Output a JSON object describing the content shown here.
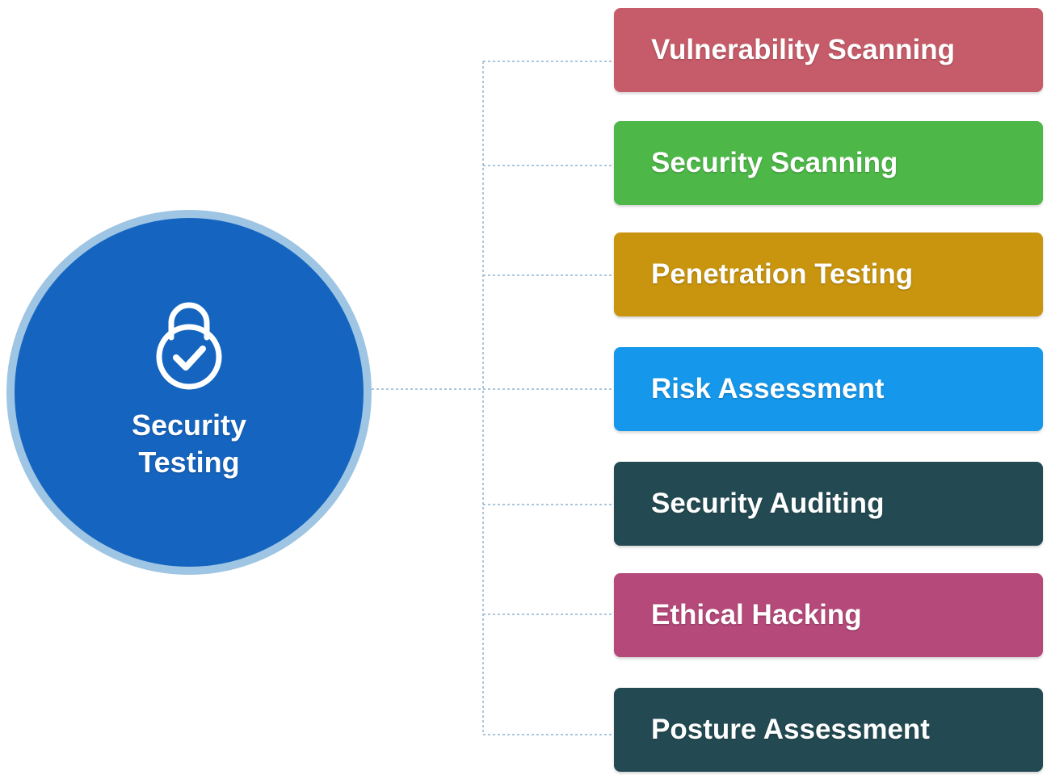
{
  "hub": {
    "title": "Security Testing",
    "icon": "lock-check-icon",
    "fill_color": "#1565c0",
    "ring_color": "#9ec5e3"
  },
  "branches": [
    {
      "label": "Vulnerability Scanning",
      "color": "#c65c69"
    },
    {
      "label": "Security Scanning",
      "color": "#4db848"
    },
    {
      "label": "Penetration Testing",
      "color": "#c9950f"
    },
    {
      "label": "Risk Assessment",
      "color": "#1597ec"
    },
    {
      "label": "Security Auditing",
      "color": "#234a52"
    },
    {
      "label": "Ethical Hacking",
      "color": "#b5497a"
    },
    {
      "label": "Posture Assessment",
      "color": "#234a52"
    }
  ],
  "connector_color": "#8fb3d0"
}
